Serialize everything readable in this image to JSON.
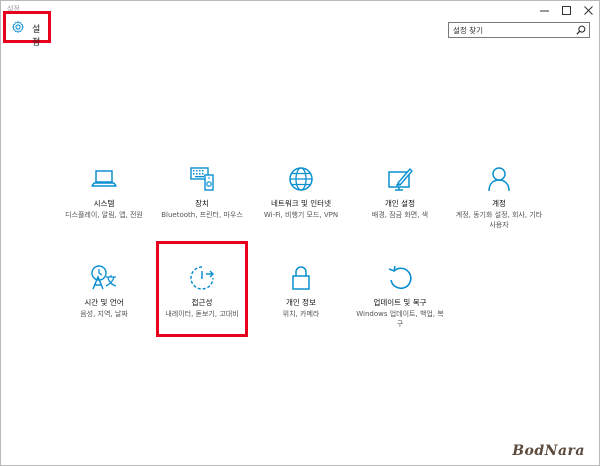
{
  "window": {
    "title": "설정",
    "controls": [
      "minimize-icon",
      "maximize-icon",
      "close-icon"
    ]
  },
  "header": {
    "icon": "gear-icon",
    "title": "설정",
    "highlight_color": "#e8001c"
  },
  "search": {
    "placeholder": "설정 찾기",
    "icon": "search-icon"
  },
  "accent_color": "#0a8fd1",
  "tiles": [
    {
      "icon": "laptop-icon",
      "name": "시스템",
      "desc": "디스플레이, 알림, 앱, 전원"
    },
    {
      "icon": "devices-icon",
      "name": "장치",
      "desc": "Bluetooth, 프린터, 마우스"
    },
    {
      "icon": "globe-icon",
      "name": "네트워크 및 인터넷",
      "desc": "Wi-Fi, 비행기 모드, VPN"
    },
    {
      "icon": "personalization-icon",
      "name": "개인 설정",
      "desc": "배경, 잠금 화면, 색"
    },
    {
      "icon": "person-icon",
      "name": "계정",
      "desc": "계정, 동기화 설정, 회사, 기타 사용자"
    },
    {
      "icon": "time-language-icon",
      "name": "시간 및 언어",
      "desc": "음성, 지역, 날짜"
    },
    {
      "icon": "ease-of-access-icon",
      "name": "접근성",
      "desc": "내레이터, 돋보기, 고대비",
      "highlighted": true
    },
    {
      "icon": "lock-icon",
      "name": "개인 정보",
      "desc": "위치, 카메라"
    },
    {
      "icon": "update-icon",
      "name": "업데이트 및 복구",
      "desc": "Windows 업데이트, 백업, 복구"
    }
  ],
  "watermark": "BodNara"
}
